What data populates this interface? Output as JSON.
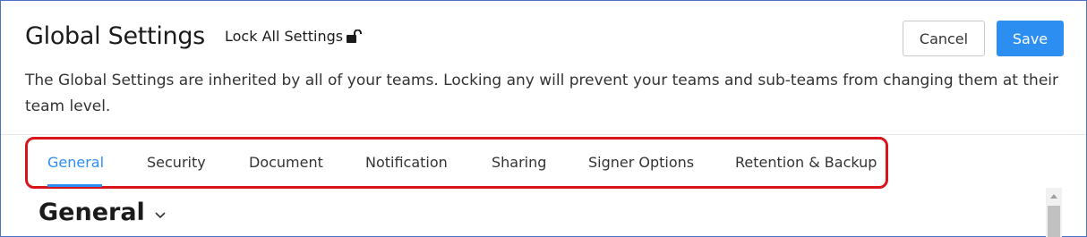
{
  "header": {
    "title": "Global Settings",
    "lock_all_label": "Lock All Settings",
    "cancel_label": "Cancel",
    "save_label": "Save",
    "description": "The Global Settings are inherited by all of your teams. Locking any will prevent your teams and sub-teams from changing them at their team level."
  },
  "tabs": [
    {
      "label": "General",
      "active": true
    },
    {
      "label": "Security",
      "active": false
    },
    {
      "label": "Document",
      "active": false
    },
    {
      "label": "Notification",
      "active": false
    },
    {
      "label": "Sharing",
      "active": false
    },
    {
      "label": "Signer Options",
      "active": false
    },
    {
      "label": "Retention & Backup",
      "active": false
    }
  ],
  "section": {
    "title": "General"
  },
  "icons": {
    "lock": "unlocked-padlock-icon",
    "section_toggle": "chevron-down-icon",
    "scroll_up": "scroll-up-arrow-icon"
  },
  "colors": {
    "accent": "#2d8ef1",
    "highlight_box": "#d9141b",
    "window_border": "#4a72c4"
  }
}
